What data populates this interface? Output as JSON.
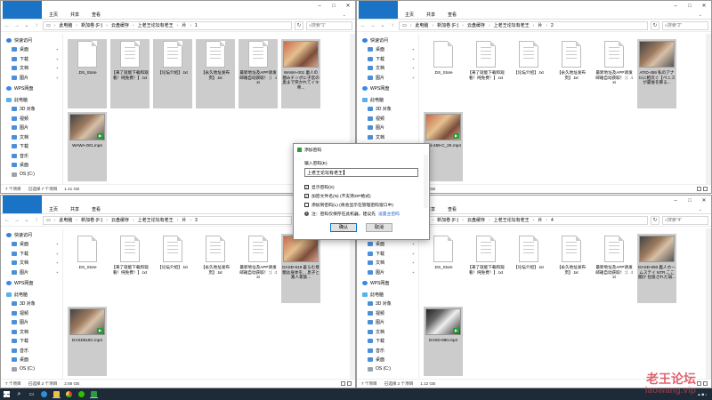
{
  "windows": [
    {
      "title": "1",
      "path": [
        "此电脑",
        "新加卷 (F:)",
        "云盘缓存",
        "上老王论坛有老王",
        "片",
        "1"
      ],
      "search": "搜索\"1\"",
      "files": [
        {
          "name": ".DS_Store",
          "type": "doc",
          "selected": true
        },
        {
          "name": "【来了就能下载和观看！纯免费！】.txt",
          "type": "doc",
          "selected": true
        },
        {
          "name": "【论坛介绍】.txt",
          "type": "doc",
          "selected": true
        },
        {
          "name": "【永久地址发布页】.txt",
          "type": "doc",
          "selected": true
        },
        {
          "name": "最新地址及APP请发邮箱自动获取！：）.txt",
          "type": "doc",
          "selected": true
        },
        {
          "name": "WAWA-001 童人の猥みチンポに子宮の奥まで突かれてイキ帝...",
          "type": "vid",
          "thumb": "a",
          "selected": true
        },
        {
          "name": "WAWA-001.mp4",
          "type": "vid",
          "thumb": "b",
          "selected": true
        }
      ],
      "status": {
        "count": "7 个项目",
        "selected": "已选择 7 个项目",
        "size": "1.41 GB"
      }
    },
    {
      "title": "2",
      "path": [
        "此电脑",
        "新加卷 (F:)",
        "云盘缓存",
        "上老王论坛有老王",
        "片",
        "2"
      ],
      "search": "搜索\"2\"",
      "files": [
        {
          "name": ".DS_Store",
          "type": "doc",
          "selected": false
        },
        {
          "name": "【来了就能下载和观看！纯免费！】.txt",
          "type": "doc",
          "selected": false
        },
        {
          "name": "【论坛介绍】.txt",
          "type": "doc",
          "selected": false
        },
        {
          "name": "【永久地址发布页】.txt",
          "type": "doc",
          "selected": false
        },
        {
          "name": "最新地址及APP请发邮箱自动获取！：）.txt",
          "type": "doc",
          "selected": false
        },
        {
          "name": "ATID-459 私のアナルに相次ぐ【ペニスが最後を飾る...",
          "type": "vid",
          "thumb": "b",
          "selected": true
        },
        {
          "name": "atid-459-C_2K.mp4",
          "type": "vid",
          "thumb": "a",
          "selected": true
        }
      ],
      "status": {
        "count": "7 个项目",
        "selected": "已选择 2 个项目",
        "size": "3.38 GB"
      }
    },
    {
      "title": "3",
      "path": [
        "此电脑",
        "新加卷 (F:)",
        "云盘缓存",
        "上老王论坛有老王",
        "片",
        "3"
      ],
      "search": "搜索\"3\"",
      "files": [
        {
          "name": ".DS_Store",
          "type": "doc",
          "selected": false
        },
        {
          "name": "【来了就能下载和观看！纯免费！】.txt",
          "type": "doc",
          "selected": false
        },
        {
          "name": "【论坛介绍】.txt",
          "type": "doc",
          "selected": false
        },
        {
          "name": "【永久地址发布页】.txt",
          "type": "doc",
          "selected": false
        },
        {
          "name": "最新地址及APP请发邮箱自动获取！：）.txt",
          "type": "doc",
          "selected": false
        },
        {
          "name": "DASD-619 羞らむ母親は身体を... 息子と素人家族...",
          "type": "vid",
          "thumb": "a",
          "selected": true
        },
        {
          "name": "DASD619C.mp4",
          "type": "vid",
          "thumb": "b",
          "selected": true
        }
      ],
      "status": {
        "count": "7 个项目",
        "selected": "已选择 2 个项目",
        "size": "2.68 GB"
      }
    },
    {
      "title": "4",
      "path": [
        "此电脑",
        "新加卷 (F:)",
        "云盘缓存",
        "上老王论坛有老王",
        "片",
        "4"
      ],
      "search": "搜索\"4\"",
      "files": [
        {
          "name": ".DS_Store",
          "type": "doc",
          "selected": false
        },
        {
          "name": "【来了就能下载和观看！纯免费！】.txt",
          "type": "doc",
          "selected": false
        },
        {
          "name": "【论坛介绍】.txt",
          "type": "doc",
          "selected": false
        },
        {
          "name": "【永久地址发布页】.txt",
          "type": "doc",
          "selected": false
        },
        {
          "name": "最新地址及APP请发邮箱自动获取！：）.txt",
          "type": "doc",
          "selected": false
        },
        {
          "name": "DASD-690 義人ホームステイ NTR ここ聞け 拉吸された弱...",
          "type": "vid",
          "thumb": "b",
          "selected": true
        },
        {
          "name": "DASD-690.mp4",
          "type": "vid",
          "thumb": "d",
          "selected": true
        }
      ],
      "status": {
        "count": "7 个项目",
        "selected": "已选择 2 个项目",
        "size": "1.12 GB"
      }
    }
  ],
  "ribbon": {
    "file": "文件",
    "home": "主页",
    "share": "共享",
    "view": "查看"
  },
  "nav": [
    {
      "label": "快速访问",
      "kind": "star",
      "group": true
    },
    {
      "label": "桌面",
      "kind": "folder",
      "pin": true
    },
    {
      "label": "下载",
      "kind": "folder",
      "pin": true
    },
    {
      "label": "文档",
      "kind": "folder",
      "pin": true
    },
    {
      "label": "图片",
      "kind": "folder",
      "pin": true
    },
    {
      "label": "WPS网盘",
      "kind": "wps",
      "group": true
    },
    {
      "label": "此电脑",
      "kind": "pc",
      "group": true
    },
    {
      "label": "3D 对象",
      "kind": "folder"
    },
    {
      "label": "视频",
      "kind": "folder"
    },
    {
      "label": "图片",
      "kind": "folder"
    },
    {
      "label": "文档",
      "kind": "folder"
    },
    {
      "label": "下载",
      "kind": "folder"
    },
    {
      "label": "音乐",
      "kind": "folder"
    },
    {
      "label": "桌面",
      "kind": "folder"
    },
    {
      "label": "OS (C:)",
      "kind": "drive"
    }
  ],
  "dialog": {
    "title": "添加密码",
    "input_label": "输入密码(E)",
    "input_value": "上老王论坛有老王",
    "opt_show": "显示密码(S)",
    "opt_encrypt": "加密文件名(N) (不支持ZIP格式)",
    "opt_save": "添加到密码(L) (将会显示在管理密码窗口中)",
    "hint": "注：密码仅保存在此机器，建议先",
    "hint_link": "设置主密码",
    "ok": "确认",
    "cancel": "取消"
  },
  "watermark": {
    "main": "老王论坛",
    "sub": "laowang.vip"
  }
}
